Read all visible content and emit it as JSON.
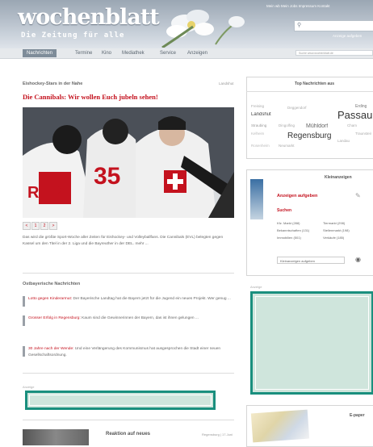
{
  "header": {
    "logo": "wochenblatt",
    "slogan": "Die Zeitung für alle",
    "top_links": "Mein wb  Mein Jobs  Impressum  Kontakt",
    "header_link": "Anzeige aufgeben"
  },
  "nav": {
    "items": [
      "Nachrichten",
      "Termine",
      "Kino",
      "Mediathek",
      "Service",
      "Anzeigen"
    ],
    "search_placeholder": "Suche   www.wochenblatt.de"
  },
  "main": {
    "kicker": "Eishockey-Stars in der Nahe",
    "kicker_right": "Landshut",
    "headline": "Die Cannibals: Wir wollen Euch jubeln sehen!",
    "slider": [
      "<",
      "1",
      "2",
      ">"
    ],
    "teaser": "Das wird die größte Sport-Woche aller Zeiten für Eishockey- und Volleyballfans. Die Cannibals (EVL) belegten gegen Kassel um den Titel in der 2. Liga und die Bayreuther in der DEL. mehr ...",
    "teaser_more": "mehr ...",
    "subhead": "Ostbayerische Nachrichten",
    "news": [
      {
        "lead": "Lotto gegen Kinderarmut:",
        "text": " Der Bayerische Landtag hat die Bayern jetzt für die Jugend ein neues Projekt. Wer genug ..."
      },
      {
        "lead": "Grosser Erfolg in Regensburg:",
        "text": " Kaum sind die Gewinnerinnen der Bayern, das ist ihnen gelungen ..."
      },
      {
        "lead": "30 Jahre nach der Wende:",
        "text": " Und eine Verlängerung des Kommunismus hat ausgesprochen die Stadt einer neuen Gesellschaftsordnung."
      }
    ],
    "ad_label": "Anzeige",
    "bottom_title": "Reaktion auf neues",
    "bottom_meta": "Regensburg | 17.Juni"
  },
  "sidebar": {
    "top_title": "Top Nachrichten aus",
    "tags": [
      {
        "text": "Landshut",
        "size": 6,
        "color": "#444"
      },
      {
        "text": "Passau",
        "size": 13,
        "color": "#333"
      },
      {
        "text": "Straubing",
        "size": 4.5,
        "color": "#999"
      },
      {
        "text": "Regensburg",
        "size": 10,
        "color": "#333"
      },
      {
        "text": "Deggendorf",
        "size": 4.5,
        "color": "#aaa"
      },
      {
        "text": "Erding",
        "size": 5,
        "color": "#777"
      },
      {
        "text": "Freising",
        "size": 4.5,
        "color": "#aaa"
      },
      {
        "text": "Mühldorf",
        "size": 7,
        "color": "#666"
      },
      {
        "text": "Dingolfing",
        "size": 4.5,
        "color": "#aaa"
      },
      {
        "text": "Kelheim",
        "size": 4.5,
        "color": "#bbb"
      },
      {
        "text": "Cham",
        "size": 4.5,
        "color": "#aaa"
      },
      {
        "text": "Rosenheim",
        "size": 4.5,
        "color": "#bbb"
      },
      {
        "text": "Neumarkt",
        "size": 4.5,
        "color": "#aaa"
      },
      {
        "text": "Landau",
        "size": 4.5,
        "color": "#aaa"
      },
      {
        "text": "Traunstein",
        "size": 4.5,
        "color": "#aaa"
      }
    ],
    "classifieds_title": "Kleinanzeigen",
    "classifieds_link": "Anzeigen aufgeben",
    "search_label": "Suchen",
    "pr_items": [
      "Kfz. Markt (288)",
      "Tiermarkt (298)",
      "Bekanntschaften (131)",
      "Stellenmarkt (198)",
      "Immobilien (501)",
      "Verkäufe (185)"
    ],
    "pr_button": "Kleinanzeigen aufgeben",
    "ad_label": "Anzeige",
    "epaper_title": "E-paper"
  },
  "colors": {
    "brand_red": "#c4121e",
    "ad_border": "#1a8f7e",
    "ad_fill": "#cfe5dc",
    "header_blue": "#9aa6b3"
  }
}
